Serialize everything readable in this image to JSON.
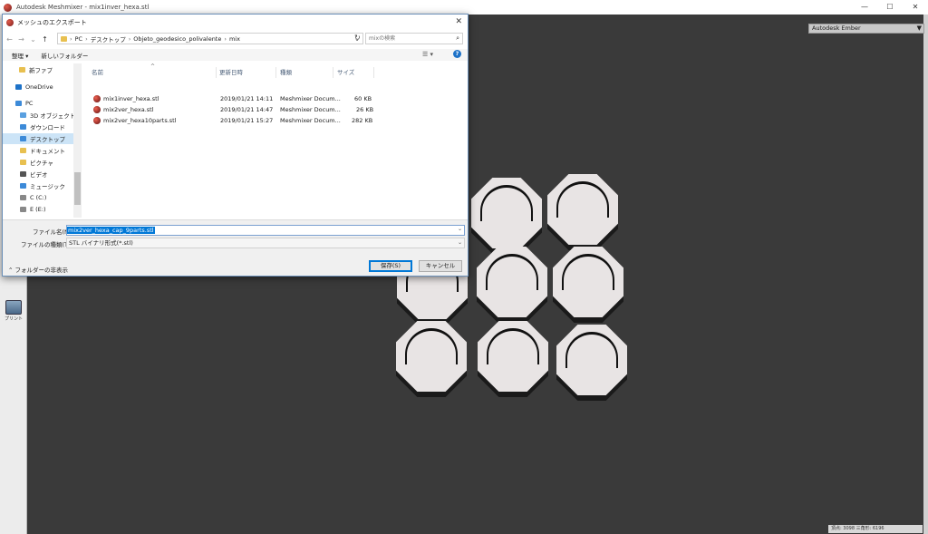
{
  "app": {
    "title": "Autodesk Meshmixer - mix1inver_hexa.stl",
    "printer": "Autodesk Ember",
    "status": "頂点: 3098 三角形: 6196",
    "print_tool_label": "プリント"
  },
  "dialog": {
    "title": "メッシュのエクスポート",
    "breadcrumbs": [
      "PC",
      "デスクトップ",
      "Objeto_geodesico_polivalente",
      "mix"
    ],
    "search_placeholder": "mixの検索",
    "organize": "整理 ▾",
    "new_folder": "新しいフォルダー",
    "nav": [
      {
        "label": "新ファプ",
        "color": "#e8c050"
      },
      {
        "label": "OneDrive",
        "color": "#1e72c8"
      },
      {
        "label": "PC",
        "color": "#3c8ad8"
      },
      {
        "label": "3D オブジェクト",
        "color": "#5aa0e0"
      },
      {
        "label": "ダウンロード",
        "color": "#3c8ad8"
      },
      {
        "label": "デスクトップ",
        "color": "#3c8ad8"
      },
      {
        "label": "ドキュメント",
        "color": "#e8c050"
      },
      {
        "label": "ピクチャ",
        "color": "#e8c050"
      },
      {
        "label": "ビデオ",
        "color": "#555555"
      },
      {
        "label": "ミュージック",
        "color": "#3c8ad8"
      },
      {
        "label": "C (C:)",
        "color": "#888888"
      },
      {
        "label": "E (E:)",
        "color": "#888888"
      }
    ],
    "columns": [
      "名前",
      "更新日時",
      "種類",
      "サイズ"
    ],
    "files": [
      {
        "name": "mix1inver_hexa.stl",
        "date": "2019/01/21 14:11",
        "type": "Meshmixer Docum...",
        "size": "60 KB"
      },
      {
        "name": "mix2ver_hexa.stl",
        "date": "2019/01/21 14:47",
        "type": "Meshmixer Docum...",
        "size": "26 KB"
      },
      {
        "name": "mix2ver_hexa10parts.stl",
        "date": "2019/01/21 15:27",
        "type": "Meshmixer Docum...",
        "size": "282 KB"
      }
    ],
    "filename_label": "ファイル名(N):",
    "filename_value": "mix2ver_hexa_cap_9parts.stl",
    "filetype_label": "ファイルの種類(T):",
    "filetype_value": "STL バイナリ形式(*.stl)",
    "hide_folders": "フォルダーの非表示",
    "save": "保存(S)",
    "cancel": "キャンセル"
  }
}
